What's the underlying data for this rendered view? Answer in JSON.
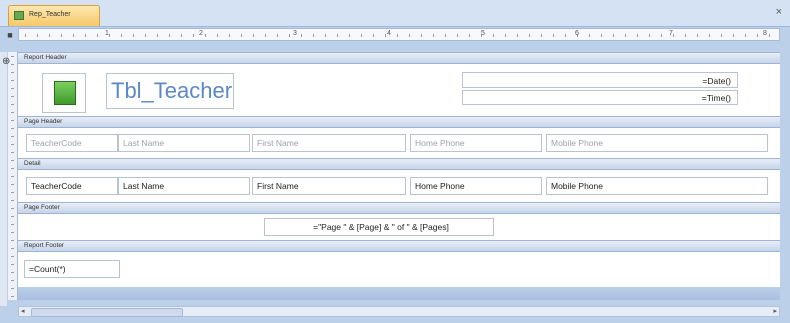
{
  "window": {
    "tab_label": "Rep_Teacher",
    "close_glyph": "×",
    "colors": {
      "accent": "#bcd0ea",
      "tab": "#f6c868",
      "title_text": "#5b88c8"
    },
    "icons": {
      "tab": "report-icon",
      "logo": "image-icon"
    }
  },
  "ruler": {
    "numbers": [
      "1",
      "2",
      "3",
      "4",
      "5",
      "6",
      "7",
      "8"
    ]
  },
  "sections": {
    "report_header": "Report Header",
    "page_header": "Page Header",
    "detail": "Detail",
    "page_footer": "Page Footer",
    "report_footer": "Report Footer"
  },
  "report_header": {
    "title": "Tbl_Teacher",
    "date_expr": "=Date()",
    "time_expr": "=Time()"
  },
  "page_header": {
    "labels": [
      "TeacherCode",
      "Last Name",
      "First Name",
      "Home Phone",
      "Mobile Phone"
    ]
  },
  "detail": {
    "fields": [
      "TeacherCode",
      "Last Name",
      "First Name",
      "Home Phone",
      "Mobile Phone"
    ]
  },
  "page_footer": {
    "page_expr": "=\"Page \" & [Page] & \" of \" & [Pages]"
  },
  "report_footer": {
    "count_expr": "=Count(*)"
  }
}
